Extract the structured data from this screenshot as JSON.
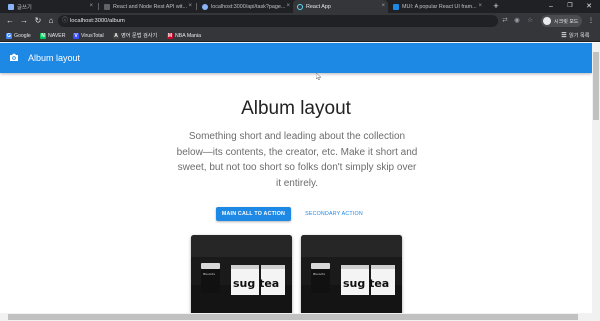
{
  "browser": {
    "tabs": [
      {
        "label": "글쓰기",
        "icon": "page-icon",
        "color": "#8ab4f8"
      },
      {
        "label": "React and Node Rest API wit...",
        "icon": "site-icon",
        "color": "#5f6368"
      },
      {
        "label": "localhost:3000/api/task?page...",
        "icon": "globe-icon",
        "color": "#8ab4f8"
      },
      {
        "label": "React App",
        "icon": "react-icon",
        "color": "#61dafb"
      },
      {
        "label": "MUI: A popular React UI fram...",
        "icon": "mui-icon",
        "color": "#1e88e5"
      }
    ],
    "new_tab": "+",
    "url": "localhost:3000/album",
    "profile_label": "시크릿 모드",
    "bookmarks": [
      {
        "label": "Google",
        "color": "#4285f4",
        "glyph": "G"
      },
      {
        "label": "NAVER",
        "color": "#03c75a",
        "glyph": "N"
      },
      {
        "label": "VirusTotal",
        "color": "#394eff",
        "glyph": "V"
      },
      {
        "label": "영어 문법 검사기",
        "color": "#444444",
        "glyph": "A"
      },
      {
        "label": "NBA Mania",
        "color": "#c9082a",
        "glyph": "M"
      }
    ],
    "reading_list": "읽기 목록"
  },
  "appbar": {
    "title": "Album layout",
    "color": "#1e88e5",
    "icon": "camera-icon"
  },
  "hero": {
    "title": "Album layout",
    "subtitle": "Something short and leading about the collection below—its contents, the creator, etc. Make it short and sweet, but not too short so folks don't simply skip over it entirely."
  },
  "buttons": {
    "main": "MAIN CALL TO ACTION",
    "secondary": "SECONDARY ACTION"
  },
  "cards": [
    {
      "image": "sugar-tea-jars-photo",
      "jar_label": "Biscuits",
      "text": "sug tea"
    },
    {
      "image": "sugar-tea-jars-photo",
      "jar_label": "Biscuits",
      "text": "sug tea"
    }
  ]
}
